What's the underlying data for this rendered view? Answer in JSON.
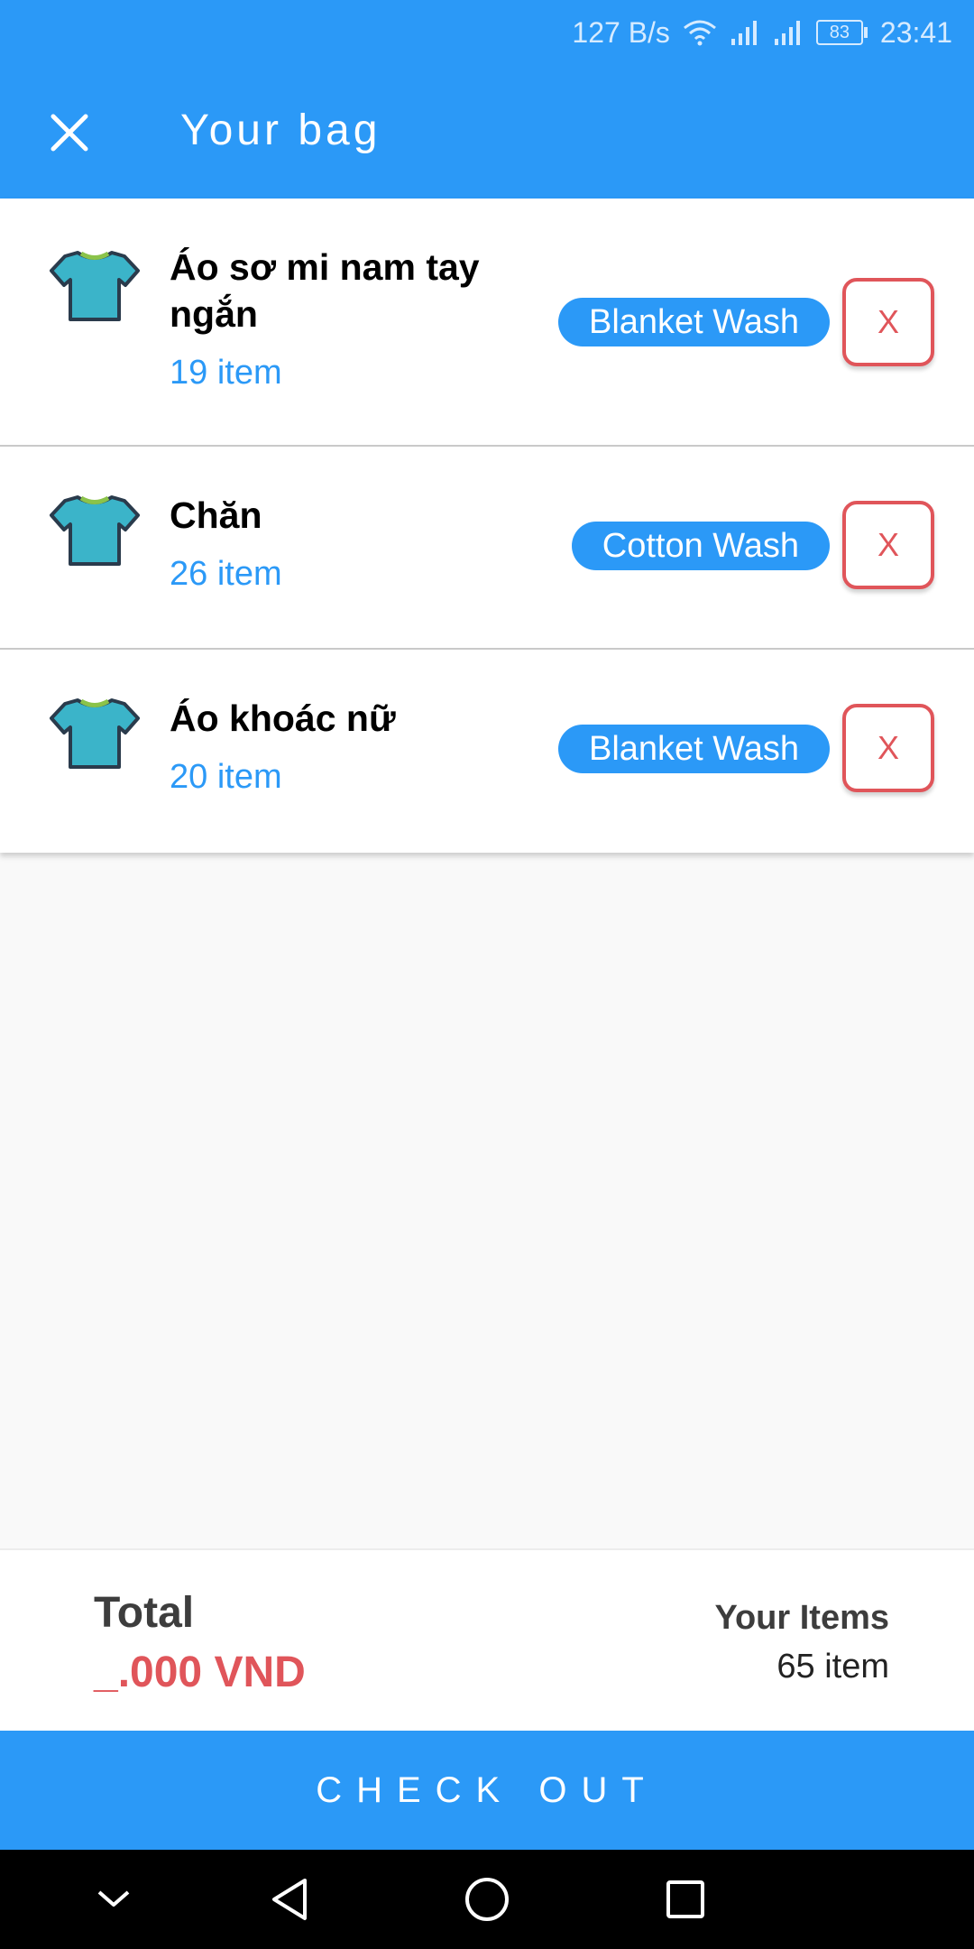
{
  "status_bar": {
    "speed": "127 B/s",
    "battery": "83",
    "time": "23:41"
  },
  "header": {
    "title": "Your bag"
  },
  "items": [
    {
      "name": "Áo sơ mi nam tay ngắn",
      "quantity": "19 item",
      "service": "Blanket Wash",
      "remove_label": "X"
    },
    {
      "name": "Chăn",
      "quantity": "26 item",
      "service": "Cotton Wash",
      "remove_label": "X"
    },
    {
      "name": "Áo khoác nữ",
      "quantity": "20 item",
      "service": "Blanket Wash",
      "remove_label": "X"
    }
  ],
  "summary": {
    "total_label": "Total",
    "total_value": "_.000 VND",
    "items_label": "Your Items",
    "items_value": "65 item"
  },
  "checkout_label": "CHECK OUT",
  "colors": {
    "primary": "#2b99f7",
    "danger": "#e0555a",
    "shirt": "#3bb4c9"
  },
  "icons": [
    "close-icon",
    "wifi-icon",
    "signal-icon",
    "battery-icon",
    "shirt-icon",
    "nav-down-icon",
    "nav-back-icon",
    "nav-home-icon",
    "nav-recents-icon"
  ]
}
